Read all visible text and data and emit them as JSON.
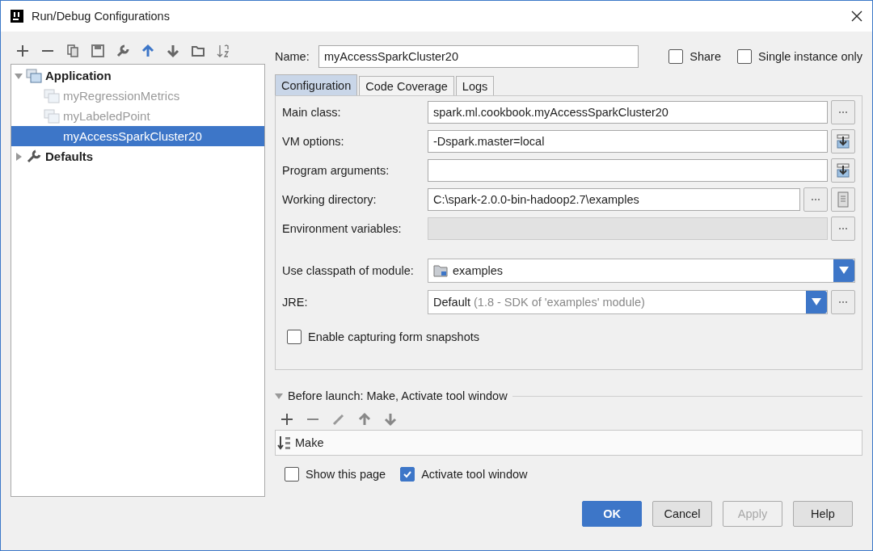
{
  "window": {
    "title": "Run/Debug Configurations"
  },
  "tree": [
    {
      "label": "Application",
      "expanded": true,
      "children": [
        {
          "label": "myRegressionMetrics",
          "disabled": true,
          "selected": false
        },
        {
          "label": "myLabeledPoint",
          "disabled": true,
          "selected": false
        },
        {
          "label": "myAccessSparkCluster20",
          "disabled": false,
          "selected": true
        }
      ]
    },
    {
      "label": "Defaults",
      "expanded": false
    }
  ],
  "name": {
    "label": "Name:",
    "value": "myAccessSparkCluster20"
  },
  "options": [
    {
      "label": "Share",
      "checked": false
    },
    {
      "label": "Single instance only",
      "checked": false
    }
  ],
  "tabs": [
    {
      "label": "Configuration",
      "selected": true
    },
    {
      "label": "Code Coverage",
      "selected": false
    },
    {
      "label": "Logs",
      "selected": false
    }
  ],
  "fields": [
    {
      "kind": "text",
      "label": "Main class:",
      "value": "spark.ml.cookbook.myAccessSparkCluster20",
      "disabled": false,
      "buttons": [
        {
          "kind": "browse"
        }
      ]
    },
    {
      "kind": "text",
      "label": "VM options:",
      "value": "-Dspark.master=local",
      "disabled": false,
      "buttons": [
        {
          "kind": "expand"
        }
      ]
    },
    {
      "kind": "text",
      "label": "Program arguments:",
      "disabled": false,
      "buttons": [
        {
          "kind": "expand"
        }
      ]
    },
    {
      "kind": "text",
      "label": "Working directory:",
      "value": "C:\\spark-2.0.0-bin-hadoop2.7\\examples",
      "disabled": false,
      "buttons": [
        {
          "kind": "browse"
        },
        {
          "kind": "macro"
        }
      ]
    },
    {
      "kind": "text",
      "label": "Environment variables:",
      "disabled": true,
      "buttons": [
        {
          "kind": "browse"
        }
      ]
    },
    {
      "kind": "module",
      "label": "Use classpath of module:",
      "value": "examples"
    },
    {
      "kind": "select",
      "label": "JRE:",
      "value": "Default",
      "hint": "(1.8 - SDK of 'examples' module)",
      "buttons": [
        {
          "kind": "browse"
        }
      ]
    }
  ],
  "capture": {
    "label": "Enable capturing form snapshots",
    "checked": false
  },
  "before_launch": {
    "title": "Before launch: Make, Activate tool window",
    "expanded": true,
    "tasks": [
      "Make"
    ]
  },
  "launch_options": [
    {
      "label": "Show this page",
      "checked": false
    },
    {
      "label": "Activate tool window",
      "checked": true
    }
  ],
  "buttons": [
    {
      "label": "OK",
      "kind": "primary",
      "disabled": false
    },
    {
      "label": "Cancel",
      "kind": "normal",
      "disabled": false
    },
    {
      "label": "Apply",
      "kind": "normal",
      "disabled": true
    },
    {
      "label": "Help",
      "kind": "normal",
      "disabled": false
    }
  ]
}
